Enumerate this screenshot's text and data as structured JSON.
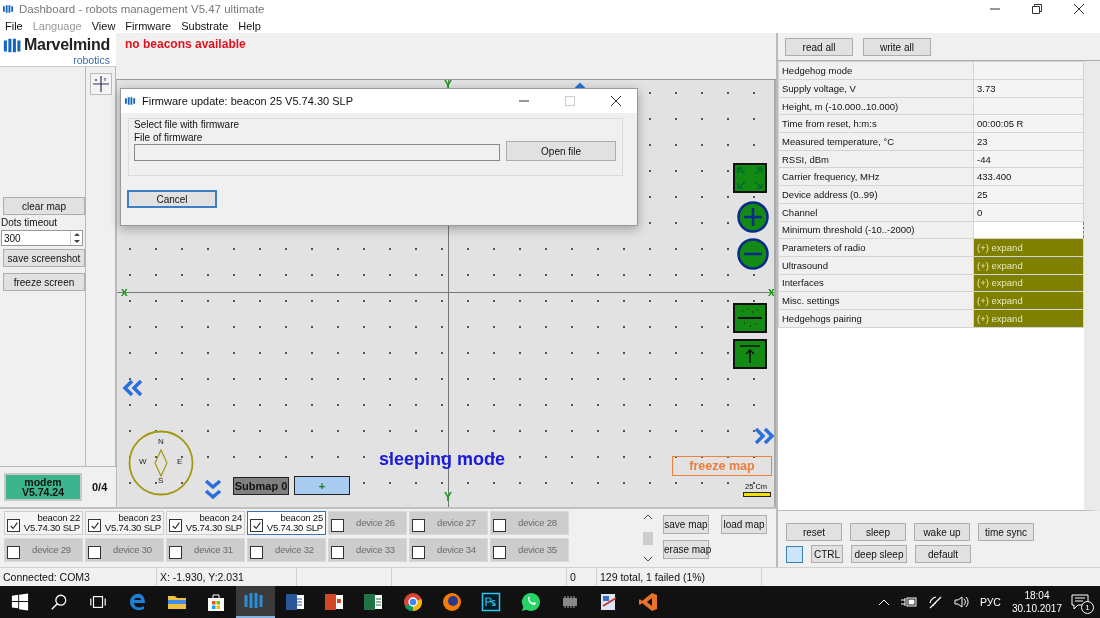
{
  "window": {
    "title": "Dashboard - robots management  V5.47  ultimate"
  },
  "menu": [
    {
      "label": "File",
      "disabled": false
    },
    {
      "label": "Language",
      "disabled": true
    },
    {
      "label": "View",
      "disabled": false
    },
    {
      "label": "Firmware",
      "disabled": false
    },
    {
      "label": "Substrate",
      "disabled": false
    },
    {
      "label": "Help",
      "disabled": false
    }
  ],
  "logo": {
    "name": "Marvelmind",
    "tagline": "robotics"
  },
  "sidebar": {
    "clear_button": "clear map",
    "timeout_label": "Dots timeout",
    "timeout_value": "300",
    "screenshot_button": "save screenshot",
    "freeze_button": "freeze screen"
  },
  "modem": {
    "label": "modem",
    "version": "V5.74.24",
    "count": "0/4"
  },
  "map": {
    "status": "no beacons available",
    "y_marks": [
      "Y",
      "Y"
    ],
    "x_marks": [
      "x",
      "x"
    ],
    "compass": {
      "north": "N",
      "west": "W",
      "east": "E",
      "south": "S"
    },
    "mode": "sleeping mode",
    "submap": "Submap 0",
    "add": "+",
    "freeze": "freeze map",
    "scale": "25 Cm"
  },
  "devices": [
    {
      "name": "beacon 22",
      "version": "V5.74.30 SLP",
      "available": true,
      "checked": true,
      "selected": false
    },
    {
      "name": "beacon 23",
      "version": "V5.74.30 SLP",
      "available": true,
      "checked": true,
      "selected": false
    },
    {
      "name": "beacon 24",
      "version": "V5.74.30 SLP",
      "available": true,
      "checked": true,
      "selected": false
    },
    {
      "name": "beacon 25",
      "version": "V5.74.30 SLP",
      "available": true,
      "checked": true,
      "selected": true
    },
    {
      "name": "device 26",
      "available": false,
      "checked": false,
      "selected": false
    },
    {
      "name": "device 27",
      "available": false,
      "checked": false,
      "selected": false
    },
    {
      "name": "device 28",
      "available": false,
      "checked": false,
      "selected": false
    },
    {
      "name": "device 29",
      "available": false,
      "checked": false,
      "selected": false
    },
    {
      "name": "device 30",
      "available": false,
      "checked": false,
      "selected": false
    },
    {
      "name": "device 31",
      "available": false,
      "checked": false,
      "selected": false
    },
    {
      "name": "device 32",
      "available": false,
      "checked": false,
      "selected": false
    },
    {
      "name": "device 33",
      "available": false,
      "checked": false,
      "selected": false
    },
    {
      "name": "device 34",
      "available": false,
      "checked": false,
      "selected": false
    },
    {
      "name": "device 35",
      "available": false,
      "checked": false,
      "selected": false
    }
  ],
  "map_buttons": {
    "save": "save map",
    "load": "load map",
    "erase": "erase map"
  },
  "dialog": {
    "title": "Firmware update: beacon 25  V5.74.30 SLP",
    "group": "Select file with firmware",
    "field_label": "File of firmware",
    "open": "Open file",
    "cancel": "Cancel"
  },
  "panel": {
    "read": "read all",
    "write": "write all",
    "params": [
      {
        "name": "Hedgehog mode",
        "kind": "text"
      },
      {
        "name": "Supply voltage, V",
        "value": "3.73",
        "kind": "text"
      },
      {
        "name": "Height, m (-10.000..10.000)",
        "kind": "text"
      },
      {
        "name": "Time from reset, h:m:s",
        "value": "00:00:05   R",
        "kind": "text"
      },
      {
        "name": "Measured temperature, °C",
        "value": "23",
        "kind": "text"
      },
      {
        "name": "RSSI, dBm",
        "value": "-44",
        "kind": "text"
      },
      {
        "name": "Carrier frequency, MHz",
        "value": "433.400",
        "kind": "text"
      },
      {
        "name": "Device address (0..99)",
        "value": "25",
        "kind": "text"
      },
      {
        "name": "Channel",
        "value": "0",
        "kind": "text"
      },
      {
        "name": "Minimum threshold (-10..-2000)",
        "kind": "invalid"
      },
      {
        "name": "Parameters of radio",
        "value": "(+) expand",
        "kind": "expand"
      },
      {
        "name": "Ultrasound",
        "value": "(+) expand",
        "kind": "expand"
      },
      {
        "name": "Interfaces",
        "value": "(+) expand",
        "kind": "expand"
      },
      {
        "name": "Misc. settings",
        "value": "(+) expand",
        "kind": "expand"
      },
      {
        "name": "Hedgehogs pairing",
        "value": "(+) expand",
        "kind": "expand"
      }
    ],
    "actions": [
      [
        "reset",
        "sleep",
        "wake up",
        "time sync"
      ],
      [
        "CTRL",
        "deep sleep",
        "default"
      ]
    ]
  },
  "status_bar": {
    "connection": "Connected: COM3",
    "position": "X: -1.930, Y:2.031",
    "count": "0",
    "summary": "129 total, 1 failed (1%)"
  },
  "taskbar": {
    "apps": [
      {
        "kind": "start",
        "selected": false
      },
      {
        "kind": "search",
        "selected": false
      },
      {
        "kind": "taskview",
        "selected": false
      },
      {
        "kind": "edge",
        "selected": false
      },
      {
        "kind": "folder",
        "selected": false
      },
      {
        "kind": "store",
        "selected": false
      },
      {
        "kind": "marvel",
        "selected": true
      },
      {
        "kind": "word",
        "selected": false
      },
      {
        "kind": "slides",
        "selected": false
      },
      {
        "kind": "sheet",
        "selected": false
      },
      {
        "kind": "chrome",
        "selected": false
      },
      {
        "kind": "firefox",
        "selected": false
      },
      {
        "kind": "ps",
        "selected": false
      },
      {
        "kind": "chat",
        "selected": false
      },
      {
        "kind": "chip",
        "selected": false
      },
      {
        "kind": "paint",
        "selected": false
      },
      {
        "kind": "vs",
        "selected": false
      }
    ],
    "language": "РУС",
    "time": "18:04",
    "date": "30.10.2017",
    "notifications": "1"
  }
}
